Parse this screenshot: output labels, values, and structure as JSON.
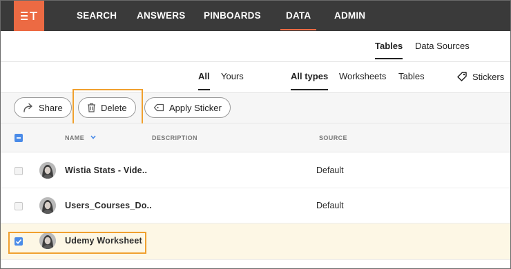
{
  "nav": {
    "logo_text": "TS",
    "items": [
      {
        "label": "SEARCH"
      },
      {
        "label": "ANSWERS"
      },
      {
        "label": "PINBOARDS"
      },
      {
        "label": "DATA",
        "active": true
      },
      {
        "label": "ADMIN"
      }
    ]
  },
  "object_tabs": [
    {
      "label": "Tables",
      "active": true
    },
    {
      "label": "Data Sources"
    }
  ],
  "owner_filter": [
    "All",
    "Yours"
  ],
  "type_filter": [
    "All types",
    "Worksheets",
    "Tables"
  ],
  "stickers_label": "Stickers",
  "actions": {
    "share": "Share",
    "delete": "Delete",
    "apply_sticker": "Apply Sticker"
  },
  "columns": {
    "name": "NAME",
    "description": "DESCRIPTION",
    "source": "SOURCE"
  },
  "rows": [
    {
      "name": "Wistia Stats - Vide..",
      "description": "",
      "source": "Default",
      "selected": false
    },
    {
      "name": "Users_Courses_Do..",
      "description": "",
      "source": "Default",
      "selected": false
    },
    {
      "name": "Udemy Worksheet",
      "description": "",
      "source": "",
      "selected": true
    }
  ],
  "colors": {
    "accent": "#ec6a43",
    "highlight": "#f0a02e",
    "checkbox": "#4a8be8",
    "nav_bg": "#3a3a3a"
  }
}
